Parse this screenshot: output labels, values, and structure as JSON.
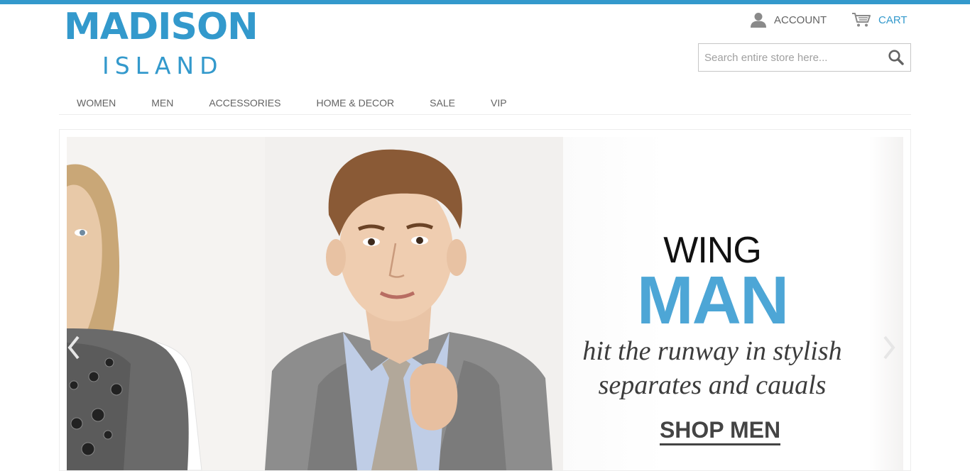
{
  "brand": {
    "name_main": "MADISON",
    "name_sub": "ISLAND",
    "accent_color": "#3399cc"
  },
  "header": {
    "account_label": "ACCOUNT",
    "account_icon": "user-icon",
    "cart_label": "CART",
    "cart_icon": "cart-icon"
  },
  "search": {
    "placeholder": "Search entire store here...",
    "value": "",
    "icon": "search-icon"
  },
  "nav": {
    "items": [
      "WOMEN",
      "MEN",
      "ACCESSORIES",
      "HOME & DECOR",
      "SALE",
      "VIP"
    ]
  },
  "slider": {
    "headline_1": "WING",
    "headline_2": "MAN",
    "tagline_line1": "hit the runway in stylish",
    "tagline_line2": "separates and cauals",
    "cta_label": "SHOP MEN",
    "headline_color": "#4da6d6",
    "prev_icon": "chevron-left-icon",
    "next_icon": "chevron-right-icon"
  }
}
